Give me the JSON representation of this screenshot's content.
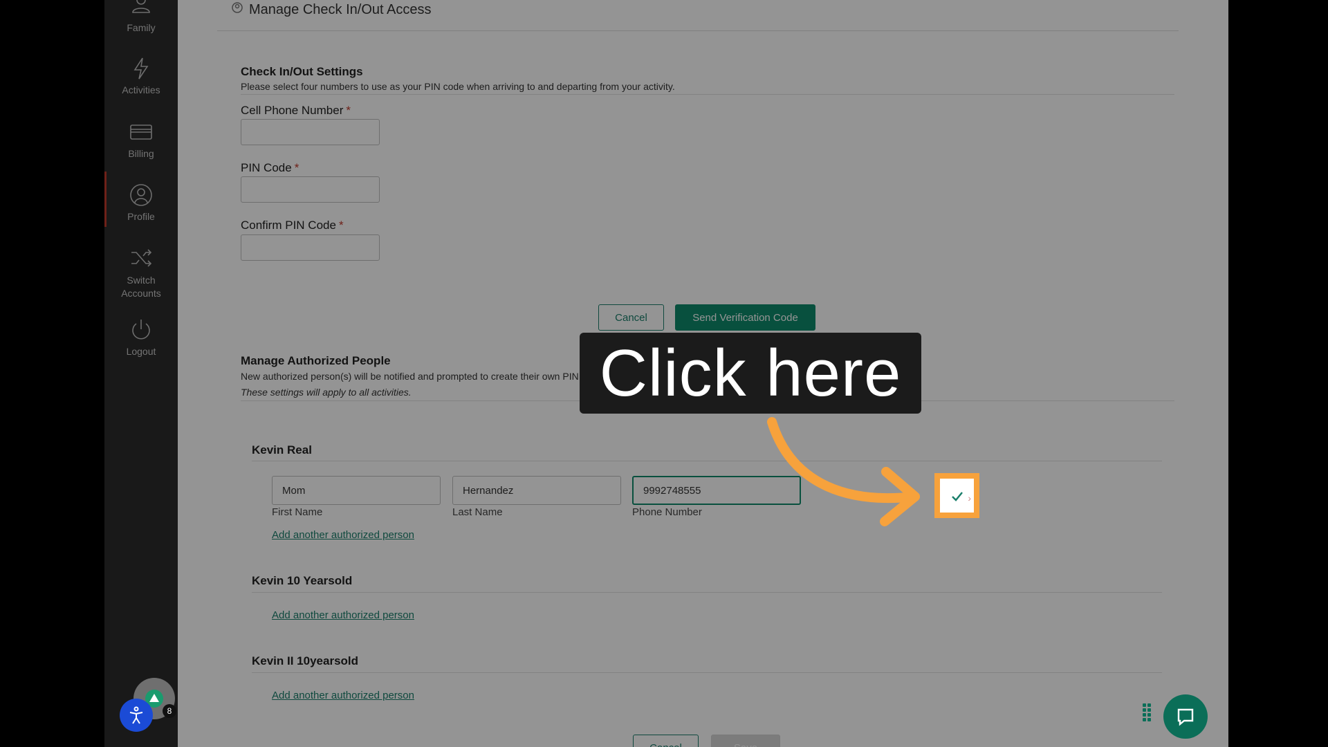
{
  "sidebar": {
    "items": [
      {
        "label": "Family",
        "icon": "family-icon"
      },
      {
        "label": "Activities",
        "icon": "lightning-icon"
      },
      {
        "label": "Billing",
        "icon": "credit-card-icon"
      },
      {
        "label": "Profile",
        "icon": "user-circle-icon"
      },
      {
        "label": "Switch Accounts",
        "icon": "shuffle-icon"
      },
      {
        "label": "Logout",
        "icon": "power-icon"
      }
    ]
  },
  "header": {
    "title": "Manage Check In/Out Access"
  },
  "checkin_settings": {
    "title": "Check In/Out Settings",
    "description": "Please select four numbers to use as your PIN code when arriving to and departing from your activity.",
    "fields": {
      "cell_phone_label": "Cell Phone Number",
      "pin_label": "PIN Code",
      "confirm_pin_label": "Confirm PIN Code",
      "required_marker": "*"
    },
    "cancel_label": "Cancel",
    "send_code_label": "Send Verification Code"
  },
  "authorized_people": {
    "title": "Manage Authorized People",
    "description": "New authorized person(s) will be notified and prompted to create their own PIN for your child(ren) and check",
    "note": "These settings will apply to all activities.",
    "children": [
      {
        "name": "Kevin Real",
        "person": {
          "first_name": "Mom",
          "last_name": "Hernandez",
          "phone": "9992748555"
        },
        "captions": {
          "first": "First Name",
          "last": "Last Name",
          "phone": "Phone Number"
        },
        "add_link": "Add another authorized person"
      },
      {
        "name": "Kevin 10 Yearsold",
        "add_link": "Add another authorized person"
      },
      {
        "name": "Kevin II 10yearsold",
        "add_link": "Add another authorized person"
      }
    ],
    "cancel_label": "Cancel",
    "save_label": "Save"
  },
  "overlay": {
    "callout_text": "Click here",
    "highlight_color": "#f7a23c"
  },
  "widgets": {
    "badge_count": "8"
  }
}
